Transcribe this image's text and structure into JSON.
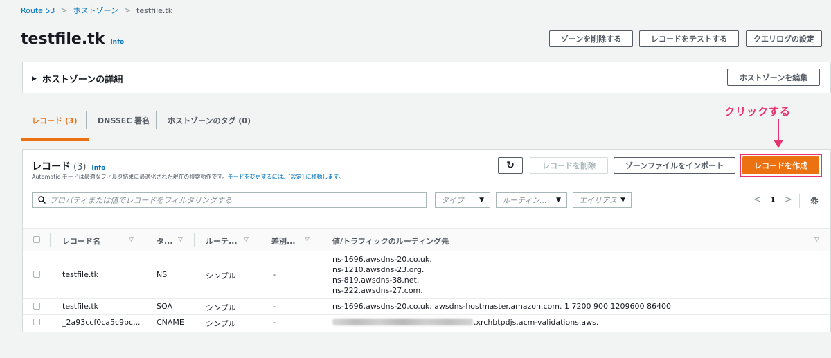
{
  "breadcrumb": {
    "root": "Route 53",
    "parent": "ホストゾーン",
    "current": "testfile.tk"
  },
  "header": {
    "title": "testfile.tk",
    "info": "Info",
    "buttons": {
      "delete_zone": "ゾーンを削除する",
      "test_record": "レコードをテストする",
      "query_log": "クエリログの設定"
    }
  },
  "details": {
    "title": "ホストゾーンの詳細",
    "edit_button": "ホストゾーンを編集",
    "toggle": "▶"
  },
  "tabs": [
    {
      "label": "レコード (3)",
      "active": true
    },
    {
      "label": "DNSSEC 署名",
      "active": false
    },
    {
      "label": "ホストゾーンのタグ (0)",
      "active": false
    }
  ],
  "annotation": {
    "text": "クリックする",
    "color": "#e8336f"
  },
  "records": {
    "title": "レコード",
    "count": "(3)",
    "info": "Info",
    "desc_prefix": "Automatic モードは最適なフィルタ結果に最適化された現在の検索動作です。",
    "desc_link1": "モードを変更するには、",
    "desc_link2": "[設定]",
    "desc_link3": " に移動します。",
    "buttons": {
      "refresh": "↻",
      "delete": "レコードを削除",
      "import": "ゾーンファイルをインポート",
      "create": "レコードを作成"
    },
    "search_placeholder": "プロパティまたは値でレコードをフィルタリングする",
    "filters": {
      "type": "タイプ",
      "routing": "ルーティン...",
      "alias": "エイリアス"
    },
    "pagination": {
      "prev": "<",
      "page": "1",
      "next": ">"
    },
    "columns": [
      "レコード名",
      "タ...",
      "ルーテ...",
      "差別...",
      "値/トラフィックのルーティング先"
    ],
    "rows": [
      {
        "name": "testfile.tk",
        "type": "NS",
        "routing": "シンプル",
        "diff": "-",
        "values": [
          "ns-1696.awsdns-20.co.uk.",
          "ns-1210.awsdns-23.org.",
          "ns-819.awsdns-38.net.",
          "ns-222.awsdns-27.com."
        ]
      },
      {
        "name": "testfile.tk",
        "type": "SOA",
        "routing": "シンプル",
        "diff": "-",
        "values": [
          "ns-1696.awsdns-20.co.uk. awsdns-hostmaster.amazon.com. 1 7200 900 1209600 86400"
        ]
      },
      {
        "name": "_2a93ccf0ca5c9bc...",
        "type": "CNAME",
        "routing": "シンプル",
        "diff": "-",
        "values": [
          ".xrchbtpdjs.acm-validations.aws."
        ]
      }
    ]
  },
  "colors": {
    "accent": "#ec7211",
    "link": "#0073bb",
    "highlight": "#e8336f"
  }
}
